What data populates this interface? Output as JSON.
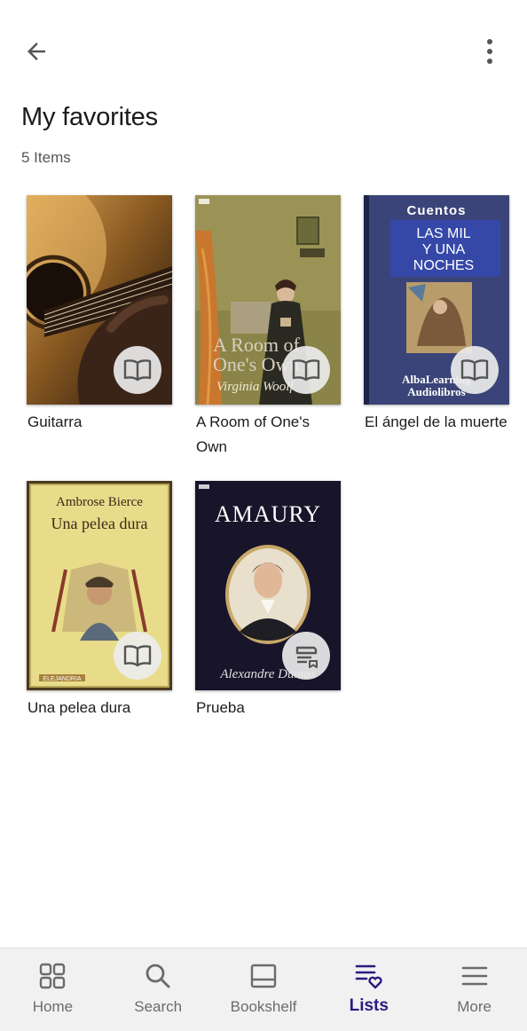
{
  "header": {
    "back_icon": "arrow-left-icon",
    "menu_icon": "more-vertical-icon",
    "title": "My favorites",
    "item_count": "5 Items"
  },
  "books": [
    {
      "title": "Guitarra",
      "format_icon": "book-open-icon"
    },
    {
      "title": "A Room of One's Own",
      "format_icon": "book-open-icon",
      "cover_text": [
        "A Room of",
        "One's Own",
        "Virginia Woolf"
      ]
    },
    {
      "title": "El ángel de la muerte",
      "format_icon": "book-open-icon",
      "cover_text": [
        "Cuentos",
        "LAS MIL",
        "Y UNA",
        "NOCHES",
        "AlbaLearning",
        "Audiolibros"
      ]
    },
    {
      "title": "Una pelea dura",
      "format_icon": "book-open-icon",
      "cover_text": [
        "Ambrose Bierce",
        "Una pelea dura",
        "ELEJANDRIA"
      ]
    },
    {
      "title": "Prueba",
      "format_icon": "audiobook-icon",
      "cover_text": [
        "AMAURY",
        "Alexandre Dumas"
      ]
    }
  ],
  "nav": [
    {
      "label": "Home",
      "icon": "grid-icon",
      "active": false
    },
    {
      "label": "Search",
      "icon": "search-icon",
      "active": false
    },
    {
      "label": "Bookshelf",
      "icon": "bookshelf-icon",
      "active": false
    },
    {
      "label": "Lists",
      "icon": "list-heart-icon",
      "active": true
    },
    {
      "label": "More",
      "icon": "menu-icon",
      "active": false
    }
  ],
  "colors": {
    "accent": "#2a1a80",
    "nav_background": "#f1f1f1",
    "text_primary": "#1c1c1c",
    "text_secondary": "#555555"
  }
}
